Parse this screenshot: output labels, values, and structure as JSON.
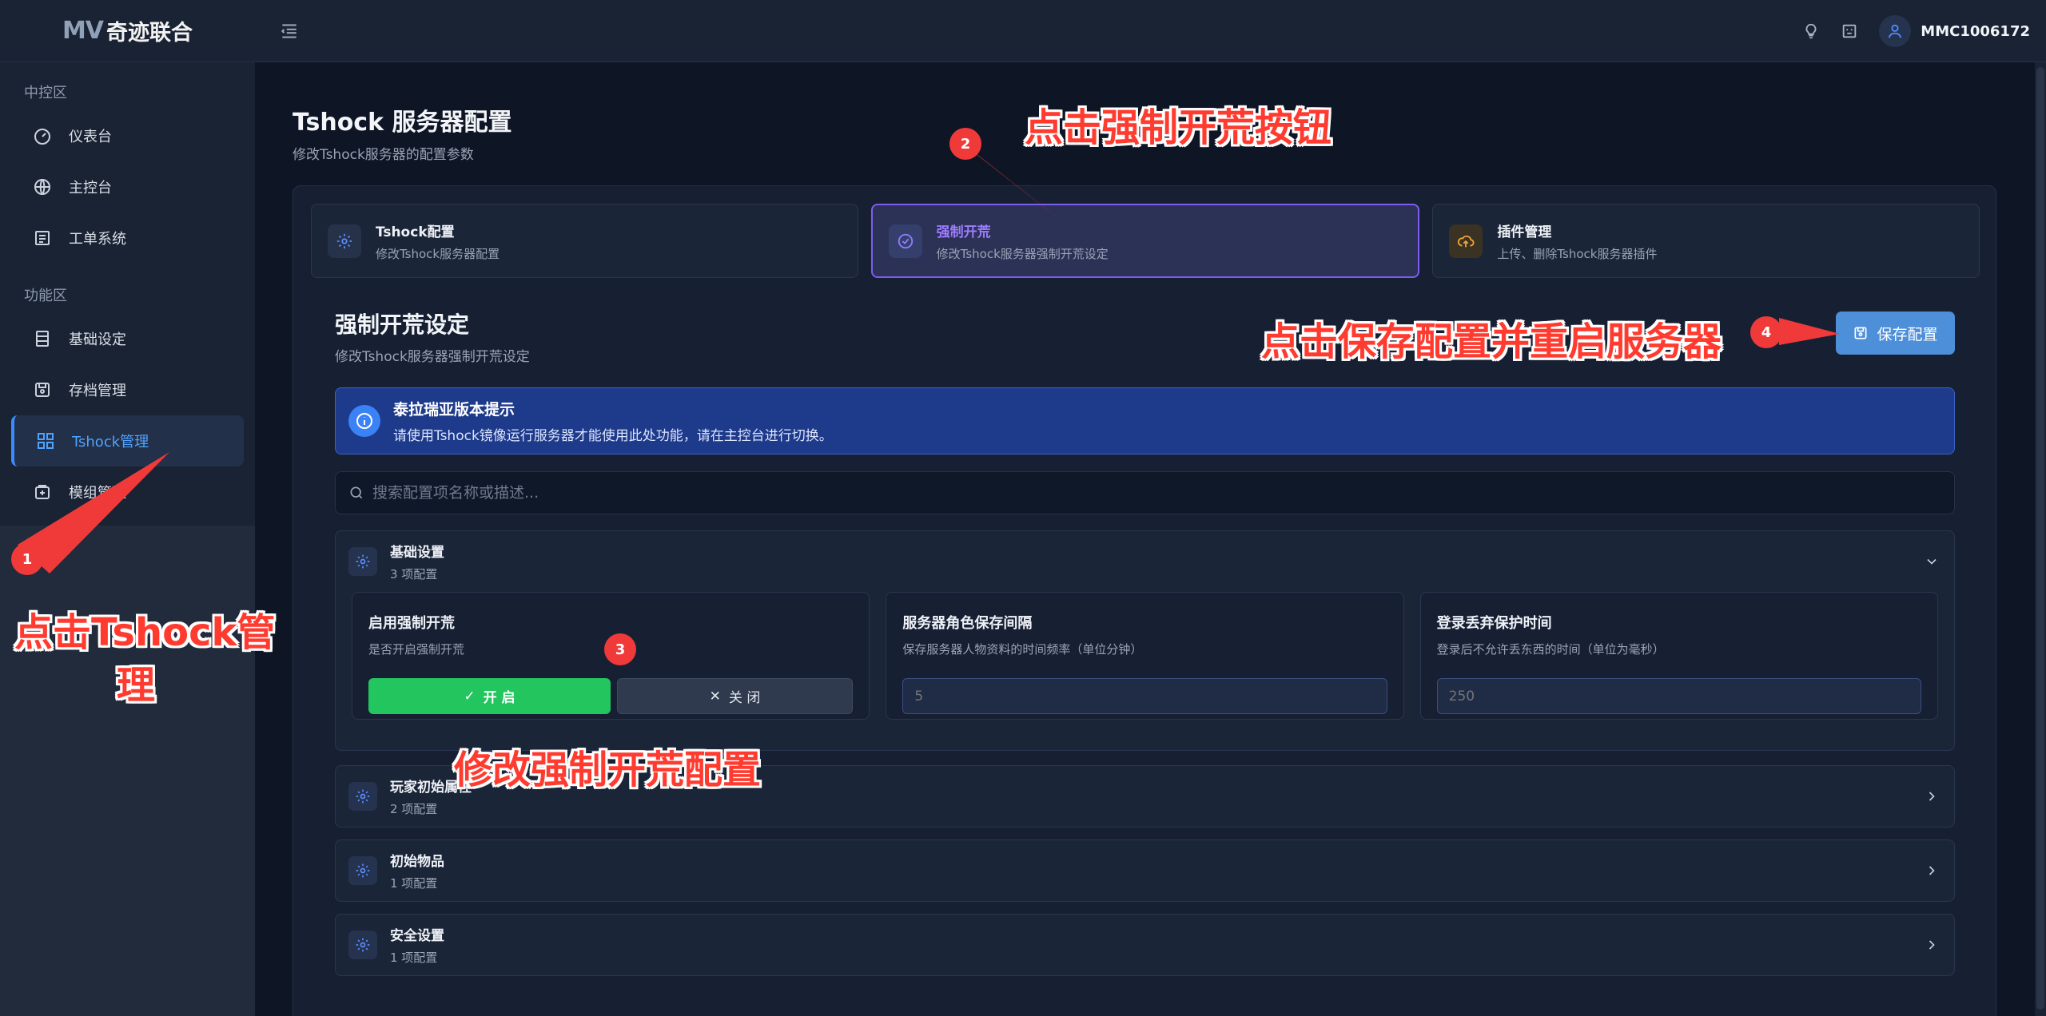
{
  "app": {
    "logo_mark": "MV",
    "logo_text": "奇迹联合",
    "username": "MMC1006172"
  },
  "sidebar": {
    "sections": [
      {
        "label": "中控区",
        "items": [
          {
            "label": "仪表台",
            "icon": "gauge-icon"
          },
          {
            "label": "主控台",
            "icon": "globe-icon"
          },
          {
            "label": "工单系统",
            "icon": "list-icon"
          }
        ]
      },
      {
        "label": "功能区",
        "items": [
          {
            "label": "基础设定",
            "icon": "server-icon"
          },
          {
            "label": "存档管理",
            "icon": "save-icon"
          },
          {
            "label": "Tshock管理",
            "icon": "grid-icon",
            "active": true
          },
          {
            "label": "模组管理",
            "icon": "box-icon"
          }
        ]
      }
    ]
  },
  "page": {
    "title": "Tshock 服务器配置",
    "subtitle": "修改Tshock服务器的配置参数"
  },
  "tabs": [
    {
      "title": "Tshock配置",
      "desc": "修改Tshock服务器配置",
      "icon": "gear-icon"
    },
    {
      "title": "强制开荒",
      "desc": "修改Tshock服务器强制开荒设定",
      "icon": "check-circle-icon",
      "active": true
    },
    {
      "title": "插件管理",
      "desc": "上传、删除Tshock服务器插件",
      "icon": "cloud-upload-icon"
    }
  ],
  "section": {
    "title": "强制开荒设定",
    "subtitle": "修改Tshock服务器强制开荒设定",
    "save_label": "保存配置"
  },
  "alert": {
    "title": "泰拉瑞亚版本提示",
    "desc": "请使用Tshock镜像运行服务器才能使用此处功能，请在主控台进行切换。"
  },
  "search": {
    "placeholder": "搜索配置项名称或描述..."
  },
  "groups": [
    {
      "title": "基础设置",
      "count": "3 项配置",
      "expanded": true
    },
    {
      "title": "玩家初始属性",
      "count": "2 项配置"
    },
    {
      "title": "初始物品",
      "count": "1 项配置"
    },
    {
      "title": "安全设置",
      "count": "1 项配置"
    }
  ],
  "settings": [
    {
      "title": "启用强制开荒",
      "desc": "是否开启强制开荒",
      "on_label": "开 启",
      "off_label": "关 闭"
    },
    {
      "title": "服务器角色保存间隔",
      "desc": "保存服务器人物资料的时间频率（单位分钟）",
      "placeholder": "5"
    },
    {
      "title": "登录丢弃保护时间",
      "desc": "登录后不允许丢东西的时间（单位为毫秒）",
      "placeholder": "250"
    }
  ],
  "annotations": {
    "a1_text_line1": "点击Tshock管",
    "a1_text_line2": "理",
    "a2_text": "点击强制开荒按钮",
    "a3_text": "修改强制开荒配置",
    "a4_text": "点击保存配置并重启服务器",
    "b1": "1",
    "b2": "2",
    "b3": "3",
    "b4": "4"
  },
  "colors": {
    "accent": "#3b8cff",
    "active_tab": "#7f5cf0",
    "save": "#4e8fd9",
    "on": "#22c55e",
    "annotation": "#ff3b30"
  }
}
